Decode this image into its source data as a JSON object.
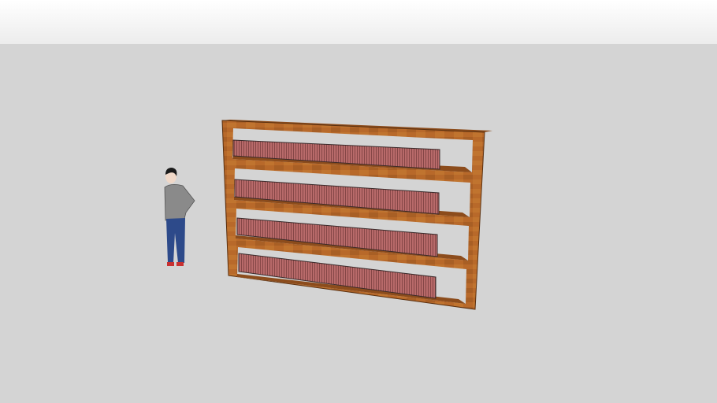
{
  "scene": {
    "colors": {
      "sky": "#f4f4f4",
      "ground": "#d4d4d4",
      "wood": "#b8692a",
      "wood_dark": "#8c4c1c",
      "books": "#b86a6a",
      "books_top": "#5a4a4a"
    }
  }
}
